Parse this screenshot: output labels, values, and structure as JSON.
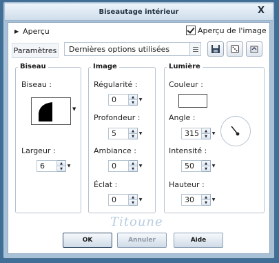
{
  "window": {
    "title": "Biseautage intérieur",
    "close_glyph": "X"
  },
  "preview": {
    "label": "Aperçu",
    "image_checkbox_label": "Aperçu de l'image",
    "image_checked": true
  },
  "presets": {
    "label": "Paramètres",
    "value": "Dernières options utilisées"
  },
  "bevel": {
    "title": "Biseau",
    "shape_label": "Biseau :",
    "width_label": "Largeur :",
    "width_value": "6"
  },
  "image": {
    "title": "Image",
    "smoothness_label": "Régularité :",
    "smoothness_value": "0",
    "depth_label": "Profondeur :",
    "depth_value": "5",
    "ambience_label": "Ambiance :",
    "ambience_value": "0",
    "shininess_label": "Éclat :",
    "shininess_value": "0"
  },
  "light": {
    "title": "Lumière",
    "color_label": "Couleur :",
    "color_value": "#ffffff",
    "angle_label": "Angle :",
    "angle_value": "315",
    "intensity_label": "Intensité :",
    "intensity_value": "50",
    "elevation_label": "Hauteur :",
    "elevation_value": "30"
  },
  "buttons": {
    "ok": "OK",
    "cancel": "Annuler",
    "help": "Aide"
  },
  "watermark": "Titoune",
  "icons": [
    "chevron-right-icon",
    "checkbox-checked-icon",
    "list-icon",
    "save-icon",
    "dice-icon",
    "reset-icon",
    "spin-up-icon",
    "spin-down-icon",
    "dropdown-arrow-icon"
  ]
}
